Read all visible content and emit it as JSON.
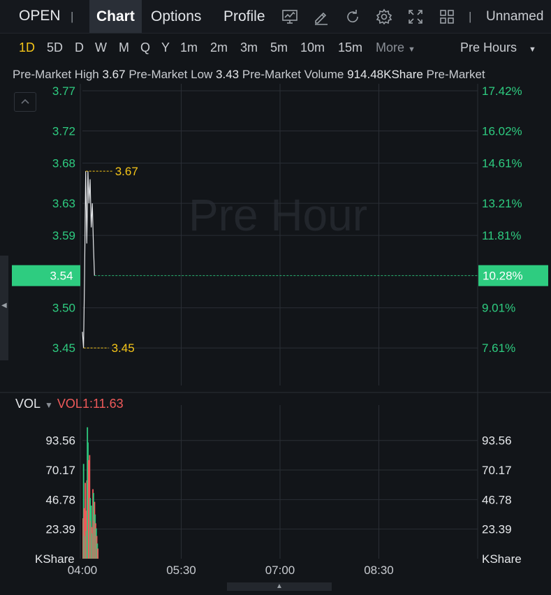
{
  "topbar": {
    "ticker": "OPEN",
    "separator": "|",
    "tabs": [
      "Chart",
      "Options",
      "Profile"
    ],
    "active_tab": "Chart",
    "tools": [
      "chart-indicator-icon",
      "draw-pencil-icon",
      "refresh-icon",
      "settings-gear-icon",
      "fullscreen-icon",
      "layout-grid-icon"
    ],
    "layout_name": "Unnamed"
  },
  "periods": {
    "items": [
      "1D",
      "5D",
      "D",
      "W",
      "M",
      "Q",
      "Y",
      "1m",
      "2m",
      "3m",
      "5m",
      "10m",
      "15m"
    ],
    "active": "1D",
    "more_label": "More",
    "session_label": "Pre Hours"
  },
  "info": {
    "high_label": "Pre-Market High",
    "high_value": "3.67",
    "low_label": "Pre-Market Low",
    "low_value": "3.43",
    "volume_label": "Pre-Market Volume",
    "volume_value": "914.48KShare",
    "trailing_label": "Pre-Market"
  },
  "price_panel": {
    "watermark": "Pre Hour",
    "current_price": "3.54",
    "current_pct": "10.28%",
    "high_marker": "3.67",
    "low_marker": "3.45"
  },
  "volume_panel": {
    "label": "VOL",
    "indicator": "VOL1:11.63",
    "unit_left": "KShare",
    "unit_right": "KShare"
  },
  "colors": {
    "up": "#2ecc80",
    "down": "#f05a5a",
    "accent": "#f5c518",
    "line": "#e6e8eb",
    "grid": "#2a2e35"
  },
  "chart_data": [
    {
      "type": "line",
      "title": "",
      "x": [
        "04:00",
        "04:01",
        "04:02",
        "04:03",
        "04:04",
        "04:05",
        "04:06",
        "04:07",
        "04:08",
        "04:09",
        "04:10",
        "04:11"
      ],
      "y": [
        3.47,
        3.45,
        3.54,
        3.67,
        3.58,
        3.67,
        3.63,
        3.66,
        3.6,
        3.63,
        3.58,
        3.54
      ],
      "x_ticks": [
        "04:00",
        "05:30",
        "07:00",
        "08:30"
      ],
      "y_ticks_left": [
        "3.77",
        "3.72",
        "3.68",
        "3.63",
        "3.59",
        "3.50",
        "3.45"
      ],
      "y_ticks_right": [
        "17.42%",
        "16.02%",
        "14.61%",
        "13.21%",
        "11.81%",
        "9.01%",
        "7.61%"
      ],
      "ylim": [
        3.425,
        3.77
      ],
      "xlim_minutes": [
        0,
        360
      ],
      "grid": true
    },
    {
      "type": "bar",
      "title": "",
      "y_ticks": [
        "93.56",
        "70.17",
        "46.78",
        "23.39"
      ],
      "ylim": [
        0,
        105
      ],
      "bars": [
        {
          "t": 0,
          "v": 32,
          "dir": "down"
        },
        {
          "t": 0.5,
          "v": 75,
          "dir": "up"
        },
        {
          "t": 1,
          "v": 40,
          "dir": "down"
        },
        {
          "t": 1.5,
          "v": 18,
          "dir": "up"
        },
        {
          "t": 2,
          "v": 60,
          "dir": "down"
        },
        {
          "t": 2.5,
          "v": 38,
          "dir": "down"
        },
        {
          "t": 3,
          "v": 22,
          "dir": "up"
        },
        {
          "t": 3.5,
          "v": 62,
          "dir": "down"
        },
        {
          "t": 4,
          "v": 104,
          "dir": "up"
        },
        {
          "t": 4.5,
          "v": 92,
          "dir": "up"
        },
        {
          "t": 5,
          "v": 78,
          "dir": "down"
        },
        {
          "t": 5.5,
          "v": 70,
          "dir": "down"
        },
        {
          "t": 6,
          "v": 82,
          "dir": "down"
        },
        {
          "t": 6.5,
          "v": 48,
          "dir": "up"
        },
        {
          "t": 7,
          "v": 30,
          "dir": "down"
        },
        {
          "t": 7.5,
          "v": 42,
          "dir": "up"
        },
        {
          "t": 8,
          "v": 25,
          "dir": "down"
        },
        {
          "t": 8.5,
          "v": 20,
          "dir": "up"
        },
        {
          "t": 9,
          "v": 55,
          "dir": "down"
        },
        {
          "t": 9.5,
          "v": 52,
          "dir": "up"
        },
        {
          "t": 10,
          "v": 30,
          "dir": "down"
        },
        {
          "t": 10.5,
          "v": 45,
          "dir": "down"
        },
        {
          "t": 11,
          "v": 35,
          "dir": "up"
        },
        {
          "t": 11.5,
          "v": 28,
          "dir": "down"
        },
        {
          "t": 12,
          "v": 24,
          "dir": "up"
        },
        {
          "t": 12.5,
          "v": 18,
          "dir": "down"
        },
        {
          "t": 13,
          "v": 12,
          "dir": "up"
        },
        {
          "t": 13.5,
          "v": 8,
          "dir": "down"
        }
      ]
    }
  ]
}
